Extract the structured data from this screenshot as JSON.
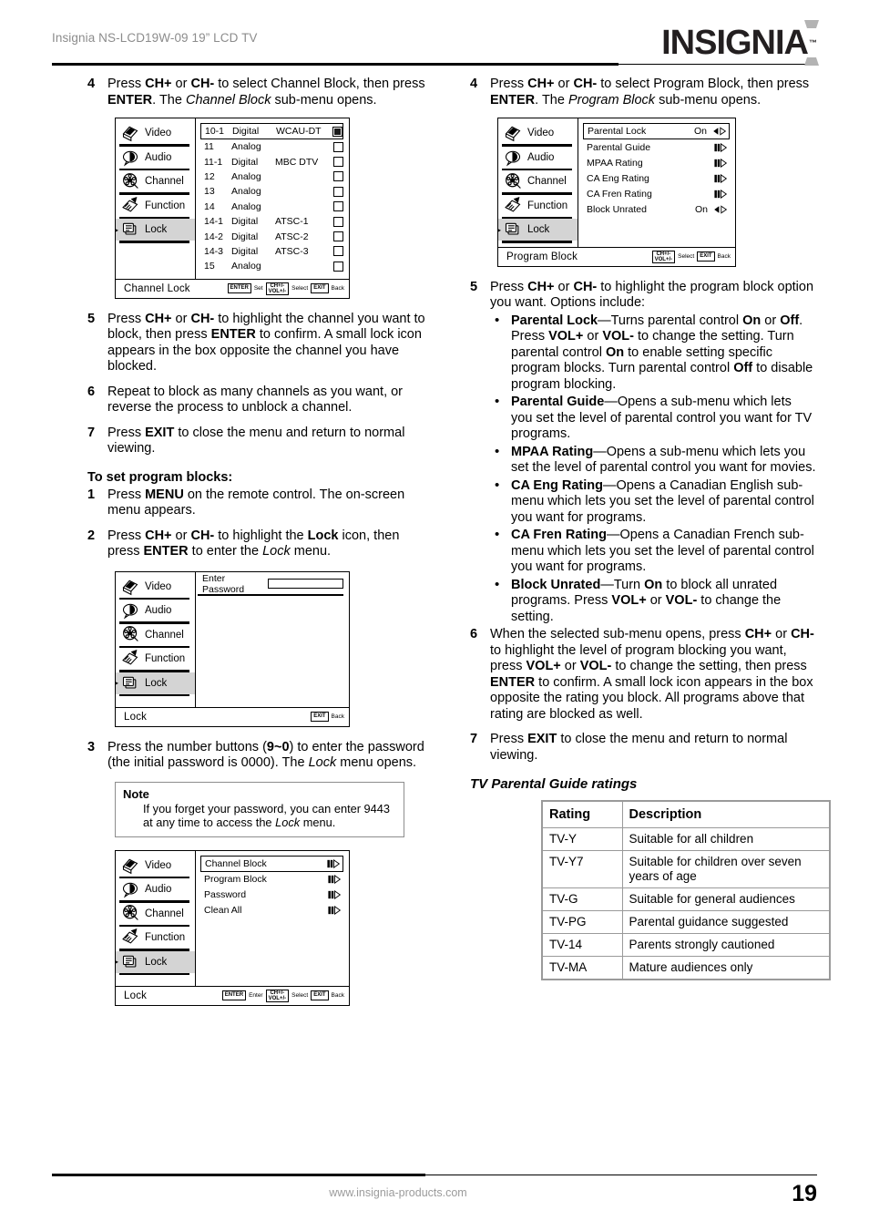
{
  "header": {
    "title": "Insignia NS-LCD19W-09 19” LCD TV",
    "logo_text": "INSIGNIA",
    "logo_tm": "™"
  },
  "footer": {
    "url": "www.insignia-products.com",
    "page_number": "19"
  },
  "left_column": {
    "step4": {
      "num": "4",
      "html": "Press <b>CH+</b> or <b>CH-</b> to select Channel Block, then press <b>ENTER</b>. The <i>Channel Block</i> sub-menu opens."
    },
    "channel_block_menu": {
      "sidebar": [
        {
          "label": "Video",
          "icon": "video-icon",
          "selected": false
        },
        {
          "label": "Audio",
          "icon": "audio-icon",
          "selected": false
        },
        {
          "label": "Channel",
          "icon": "channel-icon",
          "selected": false
        },
        {
          "label": "Function",
          "icon": "function-icon",
          "selected": false
        },
        {
          "label": "Lock",
          "icon": "lock-icon",
          "selected": true
        }
      ],
      "rows": [
        {
          "ch": "10-1",
          "type": "Digital",
          "name": "WCAU-DT",
          "locked": true,
          "highlighted": true
        },
        {
          "ch": "11",
          "type": "Analog",
          "name": "",
          "locked": false,
          "highlighted": false
        },
        {
          "ch": "11-1",
          "type": "Digital",
          "name": "MBC DTV",
          "locked": false,
          "highlighted": false
        },
        {
          "ch": "12",
          "type": "Analog",
          "name": "",
          "locked": false,
          "highlighted": false
        },
        {
          "ch": "13",
          "type": "Analog",
          "name": "",
          "locked": false,
          "highlighted": false
        },
        {
          "ch": "14",
          "type": "Analog",
          "name": "",
          "locked": false,
          "highlighted": false
        },
        {
          "ch": "14-1",
          "type": "Digital",
          "name": "ATSC-1",
          "locked": false,
          "highlighted": false
        },
        {
          "ch": "14-2",
          "type": "Digital",
          "name": "ATSC-2",
          "locked": false,
          "highlighted": false
        },
        {
          "ch": "14-3",
          "type": "Digital",
          "name": "ATSC-3",
          "locked": false,
          "highlighted": false
        },
        {
          "ch": "15",
          "type": "Analog",
          "name": "",
          "locked": false,
          "highlighted": false
        }
      ],
      "footer_label": "Channel Lock",
      "hints": [
        {
          "key": "ENTER",
          "text": "Set"
        },
        {
          "key": "CH+/-\nVOL+/-",
          "text": "Select"
        },
        {
          "key": "EXIT",
          "text": "Back"
        }
      ]
    },
    "step5": {
      "num": "5",
      "html": "Press <b>CH+</b> or <b>CH-</b> to highlight the channel you want to block, then press <b>ENTER</b> to confirm. A small lock icon appears in the box opposite the channel you have blocked."
    },
    "step6": {
      "num": "6",
      "html": "Repeat to block as many channels as you want, or reverse the process to unblock a channel."
    },
    "step7": {
      "num": "7",
      "html": "Press <b>EXIT</b> to close the menu and return to normal viewing."
    },
    "program_blocks_heading": "To set program blocks:",
    "pb_step1": {
      "num": "1",
      "html": "Press <b>MENU</b> on the remote control. The on-screen menu appears."
    },
    "pb_step2": {
      "num": "2",
      "html": "Press <b>CH+</b> or <b>CH-</b> to highlight the <b>Lock</b> icon, then press <b>ENTER</b> to enter the <i>Lock</i> menu."
    },
    "password_menu": {
      "sidebar": [
        {
          "label": "Video",
          "icon": "video-icon",
          "selected": false
        },
        {
          "label": "Audio",
          "icon": "audio-icon",
          "selected": false
        },
        {
          "label": "Channel",
          "icon": "channel-icon",
          "selected": false
        },
        {
          "label": "Function",
          "icon": "function-icon",
          "selected": false
        },
        {
          "label": "Lock",
          "icon": "lock-icon",
          "selected": true
        }
      ],
      "prompt": "Enter Password",
      "field_value": "",
      "footer_label": "Lock",
      "hints": [
        {
          "key": "EXIT",
          "text": "Back"
        }
      ]
    },
    "pb_step3": {
      "num": "3",
      "html": "Press the number buttons (<b>9~0</b>) to enter the password (the initial password is 0000). The <i>Lock</i> menu opens."
    },
    "note": {
      "title": "Note",
      "html": "If you forget your password, you can enter 9443 at any time to access the <i>Lock</i> menu."
    },
    "lock_menu": {
      "sidebar": [
        {
          "label": "Video",
          "icon": "video-icon",
          "selected": false
        },
        {
          "label": "Audio",
          "icon": "audio-icon",
          "selected": false
        },
        {
          "label": "Channel",
          "icon": "channel-icon",
          "selected": false
        },
        {
          "label": "Function",
          "icon": "function-icon",
          "selected": false
        },
        {
          "label": "Lock",
          "icon": "lock-icon",
          "selected": true
        }
      ],
      "rows": [
        {
          "label": "Channel Block",
          "value": "",
          "control": "bars",
          "highlighted": true
        },
        {
          "label": "Program Block",
          "value": "",
          "control": "bars",
          "highlighted": false
        },
        {
          "label": "Password",
          "value": "",
          "control": "bars",
          "highlighted": false
        },
        {
          "label": "Clean All",
          "value": "",
          "control": "bars",
          "highlighted": false
        }
      ],
      "footer_label": "Lock",
      "hints": [
        {
          "key": "ENTER",
          "text": "Enter"
        },
        {
          "key": "CH+/-\nVOL+/-",
          "text": "Select"
        },
        {
          "key": "EXIT",
          "text": "Back"
        }
      ]
    }
  },
  "right_column": {
    "step4": {
      "num": "4",
      "html": "Press <b>CH+</b> or <b>CH-</b> to select Program Block, then press <b>ENTER</b>. The <i>Program Block</i> sub-menu opens."
    },
    "program_block_menu": {
      "sidebar": [
        {
          "label": "Video",
          "icon": "video-icon",
          "selected": false
        },
        {
          "label": "Audio",
          "icon": "audio-icon",
          "selected": false
        },
        {
          "label": "Channel",
          "icon": "channel-icon",
          "selected": false
        },
        {
          "label": "Function",
          "icon": "function-icon",
          "selected": false
        },
        {
          "label": "Lock",
          "icon": "lock-icon",
          "selected": true
        }
      ],
      "rows": [
        {
          "label": "Parental Lock",
          "value": "On",
          "control": "lr",
          "highlighted": true
        },
        {
          "label": "Parental Guide",
          "value": "",
          "control": "bars",
          "highlighted": false
        },
        {
          "label": "MPAA Rating",
          "value": "",
          "control": "bars",
          "highlighted": false
        },
        {
          "label": "CA Eng Rating",
          "value": "",
          "control": "bars",
          "highlighted": false
        },
        {
          "label": "CA Fren Rating",
          "value": "",
          "control": "bars",
          "highlighted": false
        },
        {
          "label": "Block Unrated",
          "value": "On",
          "control": "lr",
          "highlighted": false
        }
      ],
      "footer_label": "Program Block",
      "hints": [
        {
          "key": "CH+/-\nVOL+/-",
          "text": "Select"
        },
        {
          "key": "EXIT",
          "text": "Back"
        }
      ]
    },
    "step5": {
      "num": "5",
      "html": "Press <b>CH+</b> or <b>CH-</b> to highlight the program block option you want. Options include:"
    },
    "bullets": [
      {
        "html": "<b>Parental Lock</b>—Turns parental control <b>On</b> or <b>Off</b>. Press <b>VOL+</b> or <b>VOL-</b> to change the setting. Turn parental control <b>On</b> to enable setting specific program blocks. Turn parental control <b>Off</b> to disable program blocking."
      },
      {
        "html": "<b>Parental Guide</b>—Opens a sub-menu which lets you set the level of parental control you want for TV programs."
      },
      {
        "html": "<b>MPAA Rating</b>—Opens a sub-menu which lets you set the level of parental control you want for movies."
      },
      {
        "html": "<b>CA Eng Rating</b>—Opens a Canadian English sub-menu which lets you set the level of parental control you want for programs."
      },
      {
        "html": "<b>CA Fren Rating</b>—Opens a Canadian French sub-menu which lets you set the level of parental control you want for programs."
      },
      {
        "html": "<b>Block Unrated</b>—Turn <b>On</b> to block all unrated programs. Press <b>VOL+</b> or <b>VOL-</b> to change the setting."
      }
    ],
    "step6": {
      "num": "6",
      "html": "When the selected sub-menu opens, press <b>CH+</b> or <b>CH-</b> to highlight the level of program blocking you want, press <b>VOL+</b> or <b>VOL-</b> to change the setting, then press <b>ENTER</b> to confirm. A small lock icon appears in the box opposite the rating you block. All programs above that rating are blocked as well."
    },
    "step7": {
      "num": "7",
      "html": "Press <b>EXIT</b> to close the menu and return to normal viewing."
    },
    "ratings_heading": "TV Parental Guide ratings",
    "ratings_table": {
      "columns": [
        "Rating",
        "Description"
      ],
      "rows": [
        [
          "TV-Y",
          "Suitable for all children"
        ],
        [
          "TV-Y7",
          "Suitable for children over seven years of age"
        ],
        [
          "TV-G",
          "Suitable for general audiences"
        ],
        [
          "TV-PG",
          "Parental guidance suggested"
        ],
        [
          "TV-14",
          "Parents strongly cautioned"
        ],
        [
          "TV-MA",
          "Mature audiences only"
        ]
      ]
    }
  }
}
